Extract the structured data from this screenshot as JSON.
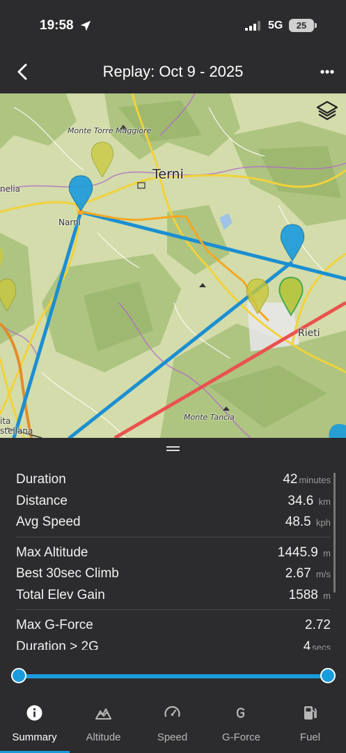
{
  "status_bar": {
    "time": "19:58",
    "network": "5G",
    "battery": "25"
  },
  "header": {
    "title": "Replay:  Oct 9 - 2025",
    "back_icon": "chevron-left-icon",
    "more_icon": "more-horizontal-icon"
  },
  "map": {
    "labels": {
      "monte_torre_maggiore": "Monte Torre Maggiore",
      "terni": "Terni",
      "narni": "Narni",
      "melia": "nelia",
      "rieti": "Rieti",
      "monte_tancia": "Monte Tancia",
      "civita_castellana": "ita stellana"
    },
    "layers_icon": "layers-icon",
    "colors": {
      "track": "#f5a623",
      "route_line": "#1b8fd1",
      "airspace_line": "#e9524f",
      "pin_blue": "#1a9bdc",
      "pin_yellow": "#c9c83a"
    }
  },
  "stats": {
    "groups": [
      [
        {
          "label": "Duration",
          "value": "42",
          "unit": "minutes"
        },
        {
          "label": "Distance",
          "value": "34.6",
          "unit": "km"
        },
        {
          "label": "Avg Speed",
          "value": "48.5",
          "unit": "kph"
        }
      ],
      [
        {
          "label": "Max Altitude",
          "value": "1445.9",
          "unit": "m"
        },
        {
          "label": "Best 30sec Climb",
          "value": "2.67",
          "unit": "m/s"
        },
        {
          "label": "Total Elev Gain",
          "value": "1588",
          "unit": "m"
        }
      ],
      [
        {
          "label": "Max G-Force",
          "value": "2.72",
          "unit": ""
        },
        {
          "label": "Duration > 2G",
          "value": "4",
          "unit": "secs"
        }
      ]
    ]
  },
  "slider": {
    "start_fraction": 0.0,
    "end_fraction": 1.0,
    "color": "#1a9bdc"
  },
  "tabs": [
    {
      "label": "Summary",
      "icon": "info-icon",
      "active": true
    },
    {
      "label": "Altitude",
      "icon": "mountain-icon",
      "active": false
    },
    {
      "label": "Speed",
      "icon": "speedometer-icon",
      "active": false
    },
    {
      "label": "G-Force",
      "icon": "g-force-icon",
      "active": false
    },
    {
      "label": "Fuel",
      "icon": "fuel-pump-icon",
      "active": false
    }
  ]
}
